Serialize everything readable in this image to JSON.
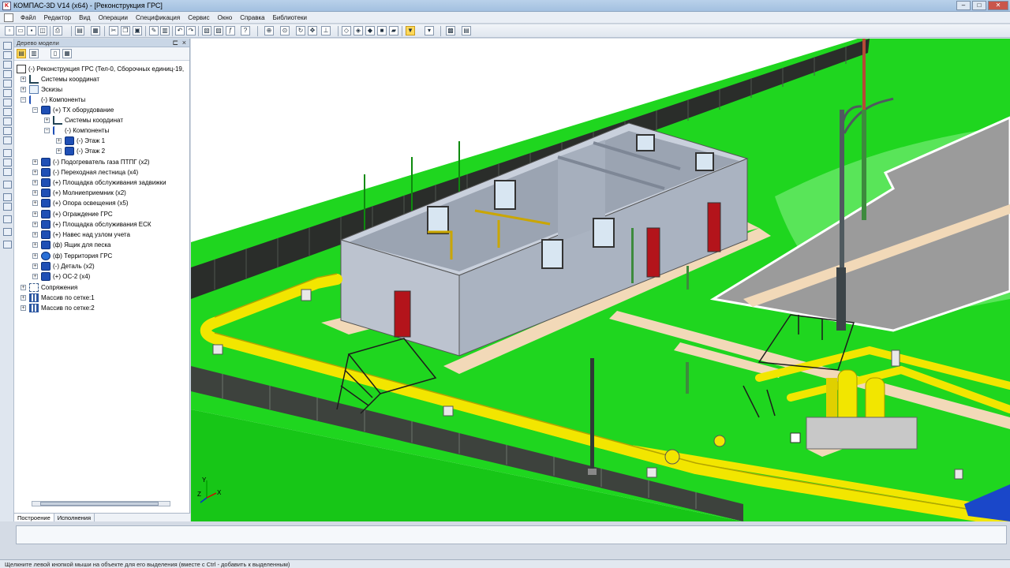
{
  "window": {
    "title": "КОМПАС-3D V14 (x64) - [Реконструкция ГРС]"
  },
  "menu": [
    "Файл",
    "Редактор",
    "Вид",
    "Операции",
    "Спецификация",
    "Сервис",
    "Окно",
    "Справка",
    "Библиотеки"
  ],
  "tree_panel": {
    "title": "Дерево модели",
    "items": [
      {
        "label": "(-) Реконструкция ГРС (Тел-0, Сборочных единиц-19,",
        "icon": "assembly-root-icon"
      },
      {
        "label": "Системы координат",
        "icon": "coordinate-system-icon"
      },
      {
        "label": "Эскизы",
        "icon": "sketch-icon"
      },
      {
        "label": "(-) Компоненты",
        "icon": "components-icon"
      },
      {
        "label": "(+) ТХ оборудование",
        "icon": "assembly-icon"
      },
      {
        "label": "Системы координат",
        "icon": "coordinate-system-icon"
      },
      {
        "label": "(-) Компоненты",
        "icon": "components-icon"
      },
      {
        "label": "(-) Этаж 1",
        "icon": "assembly-icon"
      },
      {
        "label": "(-) Этаж 2",
        "icon": "assembly-icon"
      },
      {
        "label": "(-) Подогреватель газа ПТПГ (x2)",
        "icon": "assembly-icon"
      },
      {
        "label": "(-) Переходная лестница (x4)",
        "icon": "assembly-icon"
      },
      {
        "label": "(+) Площадка обслуживания задвижки",
        "icon": "assembly-icon"
      },
      {
        "label": "(+) Молниеприемник (x2)",
        "icon": "assembly-icon"
      },
      {
        "label": "(+) Опора освещения (x5)",
        "icon": "assembly-icon"
      },
      {
        "label": "(+) Ограждение ГРС",
        "icon": "assembly-icon"
      },
      {
        "label": "(+) Площадка обслуживания ЕСК",
        "icon": "assembly-icon"
      },
      {
        "label": "(+) Навес над узлом учета",
        "icon": "assembly-icon"
      },
      {
        "label": "(ф) Ящик для песка",
        "icon": "assembly-icon"
      },
      {
        "label": "(ф) Территория ГРС",
        "icon": "part-icon"
      },
      {
        "label": "(-) Деталь (x2)",
        "icon": "assembly-icon"
      },
      {
        "label": "(+) ОС-2 (x4)",
        "icon": "assembly-icon"
      },
      {
        "label": "Сопряжения",
        "icon": "mates-icon"
      },
      {
        "label": "Массив по сетке:1",
        "icon": "array-icon"
      },
      {
        "label": "Массив по сетке:2",
        "icon": "array-icon"
      }
    ],
    "tabs": [
      "Построение",
      "Исполнения"
    ]
  },
  "axes": {
    "x": "X",
    "y": "Y",
    "z": "Z"
  },
  "status": "Щелкните левой кнопкой мыши на объекте для его выделения (вместе с Ctrl - добавить к выделенным)",
  "colors": {
    "grass": "#1fd61f",
    "pipe": "#f2e600",
    "building": "#aeb7c6",
    "road": "#9a9a9a",
    "path": "#f2d9b8",
    "fence": "#2c2c2c",
    "door": "#b3141b"
  }
}
